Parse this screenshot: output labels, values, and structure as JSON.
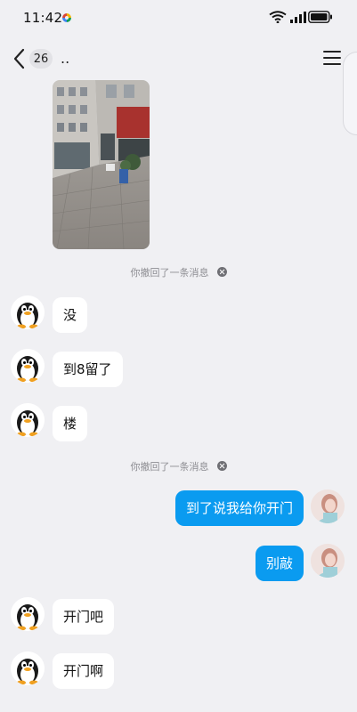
{
  "status_bar": {
    "time": "11:42"
  },
  "header": {
    "unread_count": "26",
    "title": ".."
  },
  "messages": {
    "recall_notice_1": "你撤回了一条消息",
    "in_1": "没",
    "in_2": "到8留了",
    "in_3": "楼",
    "recall_notice_2": "你撤回了一条消息",
    "out_1": "到了说我给你开门",
    "out_2": "别敲",
    "in_4": "开门吧",
    "in_5": "开门啊"
  },
  "icons": {
    "back": "chevron-left-icon",
    "menu": "hamburger-menu-icon",
    "recall_dismiss": "close-circle-icon"
  },
  "colors": {
    "background": "#f0f0f3",
    "outgoing_bubble": "#0a9bf0",
    "incoming_bubble": "#ffffff"
  }
}
